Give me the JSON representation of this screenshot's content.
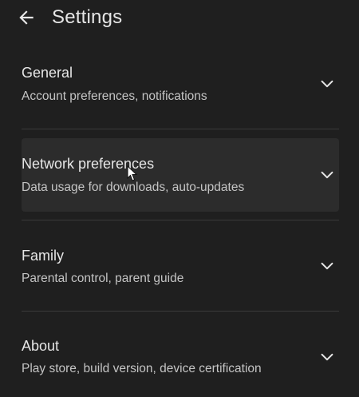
{
  "header": {
    "title": "Settings",
    "back_icon": "arrow-left-icon"
  },
  "sections": [
    {
      "title": "General",
      "subtitle": "Account preferences, notifications",
      "icon": "chevron-down-icon"
    },
    {
      "title": "Network preferences",
      "subtitle": "Data usage for downloads, auto-updates",
      "icon": "chevron-down-icon",
      "hovered": true
    },
    {
      "title": "Family",
      "subtitle": "Parental control, parent guide",
      "icon": "chevron-down-icon"
    },
    {
      "title": "About",
      "subtitle": "Play store, build version, device certification",
      "icon": "chevron-down-icon"
    }
  ],
  "colors": {
    "background": "#1f1f1f",
    "hover_background": "#2c2c2c",
    "text_primary": "#e6e6e6",
    "text_secondary": "#c4c4c4",
    "divider": "#3a3a3a"
  }
}
